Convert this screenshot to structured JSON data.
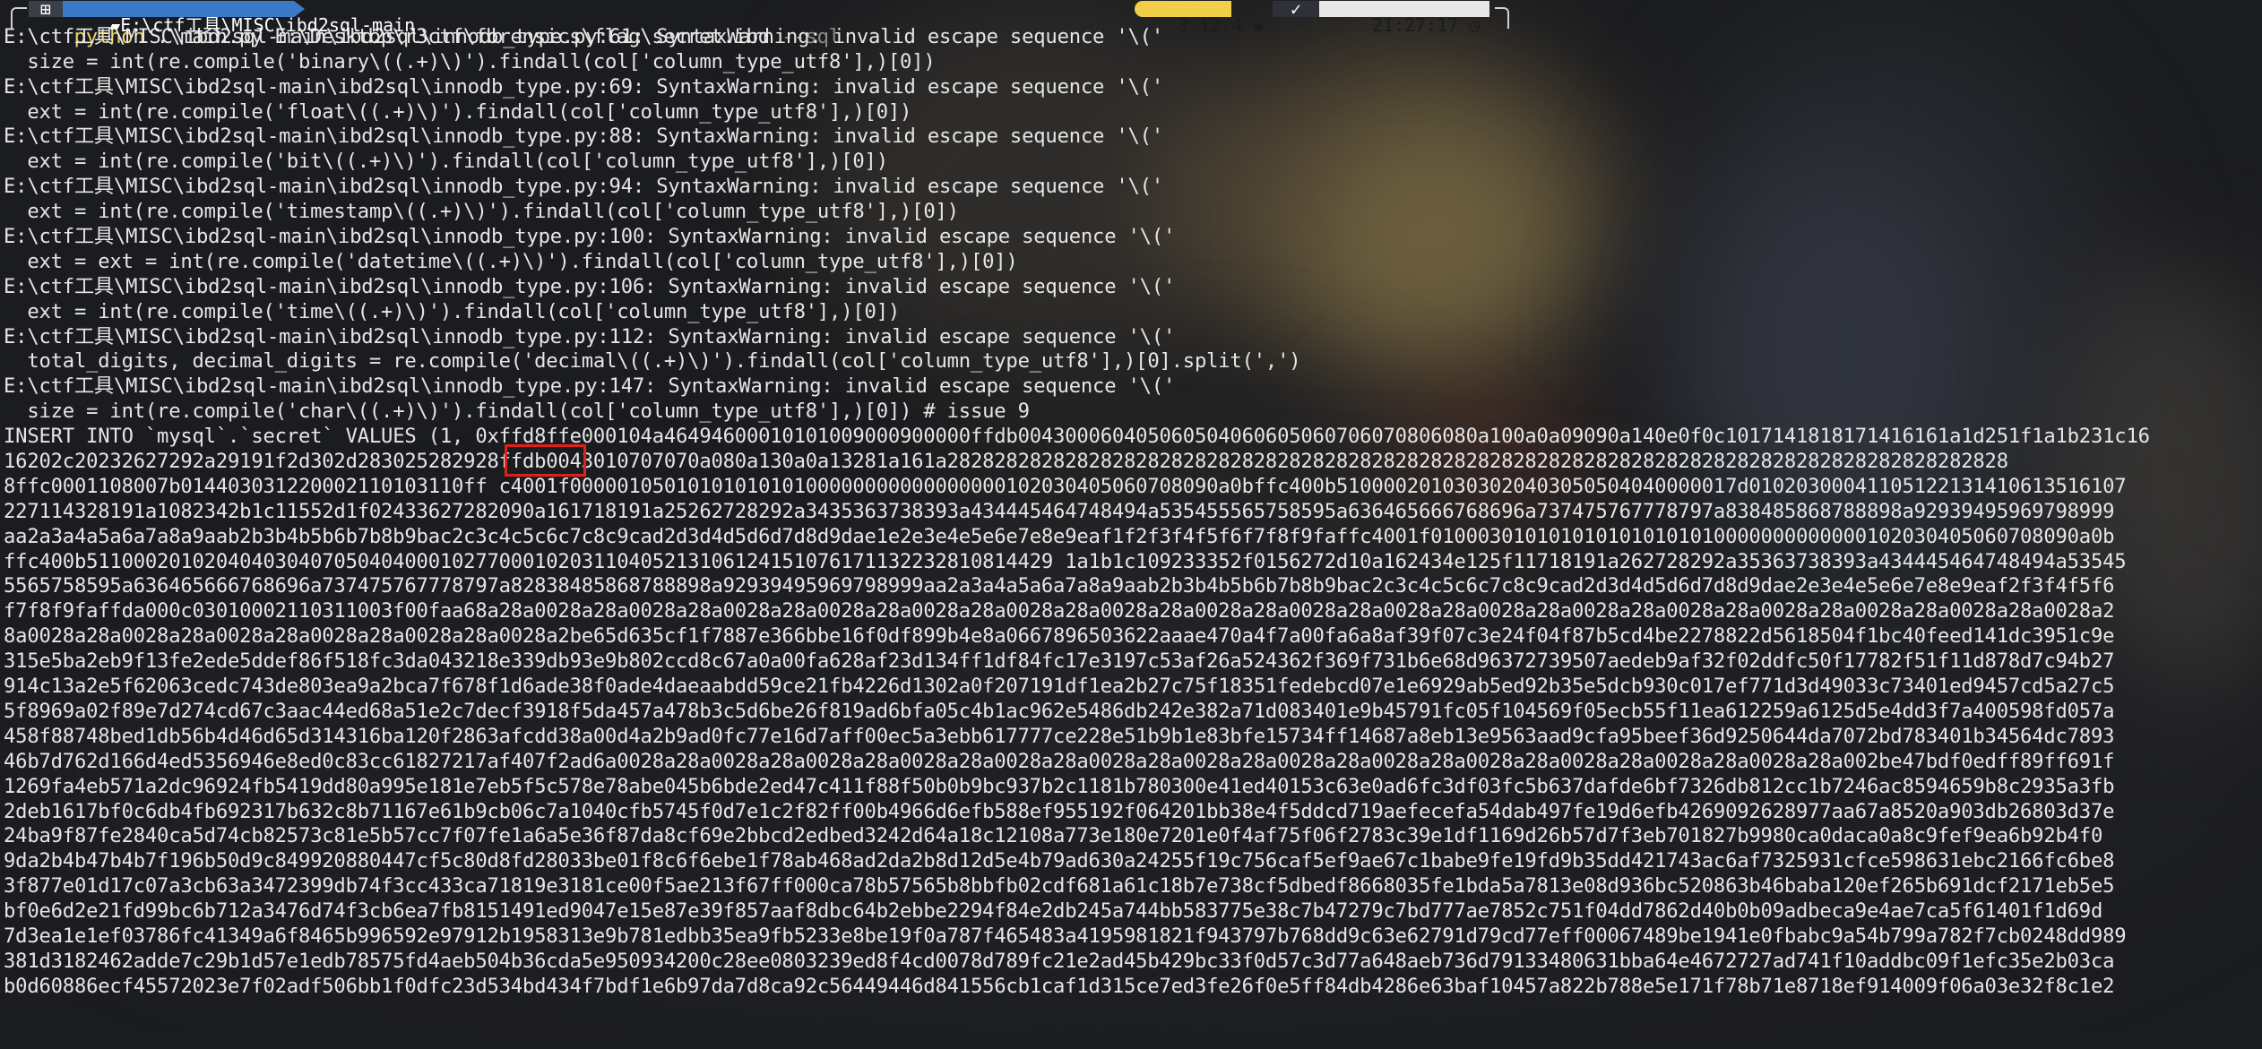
{
  "prompt": {
    "os_icon": "windows-icon",
    "folder_icon": "folder-icon",
    "path": "E:\\ctf工具\\MISC\\ibd2sql-main",
    "python_version": "3.12.4",
    "python_icon": "python-icon",
    "status_icon": "check-icon",
    "time": "21:27:17",
    "clock_icon": "clock-icon"
  },
  "command": {
    "exe": "python",
    "args": " .\\main.py E:\\Desktop\\r3ctf\\forensics\\flag\\secret.ibd ",
    "flag": "--sql"
  },
  "output_lines": [
    "E:\\ctf工具\\MISC\\ibd2sql-main\\ibd2sql\\innodb_type.py:61: SyntaxWarning: invalid escape sequence '\\('",
    "  size = int(re.compile('binary\\((.+)\\)').findall(col['column_type_utf8'],)[0])",
    "E:\\ctf工具\\MISC\\ibd2sql-main\\ibd2sql\\innodb_type.py:69: SyntaxWarning: invalid escape sequence '\\('",
    "  ext = int(re.compile('float\\((.+)\\)').findall(col['column_type_utf8'],)[0])",
    "E:\\ctf工具\\MISC\\ibd2sql-main\\ibd2sql\\innodb_type.py:88: SyntaxWarning: invalid escape sequence '\\('",
    "  ext = int(re.compile('bit\\((.+)\\)').findall(col['column_type_utf8'],)[0])",
    "E:\\ctf工具\\MISC\\ibd2sql-main\\ibd2sql\\innodb_type.py:94: SyntaxWarning: invalid escape sequence '\\('",
    "  ext = int(re.compile('timestamp\\((.+)\\)').findall(col['column_type_utf8'],)[0])",
    "E:\\ctf工具\\MISC\\ibd2sql-main\\ibd2sql\\innodb_type.py:100: SyntaxWarning: invalid escape sequence '\\('",
    "  ext = ext = int(re.compile('datetime\\((.+)\\)').findall(col['column_type_utf8'],)[0])",
    "E:\\ctf工具\\MISC\\ibd2sql-main\\ibd2sql\\innodb_type.py:106: SyntaxWarning: invalid escape sequence '\\('",
    "  ext = int(re.compile('time\\((.+)\\)').findall(col['column_type_utf8'],)[0])",
    "E:\\ctf工具\\MISC\\ibd2sql-main\\ibd2sql\\innodb_type.py:112: SyntaxWarning: invalid escape sequence '\\('",
    "  total_digits, decimal_digits = re.compile('decimal\\((.+)\\)').findall(col['column_type_utf8'],)[0].split(',')",
    "E:\\ctf工具\\MISC\\ibd2sql-main\\ibd2sql\\innodb_type.py:147: SyntaxWarning: invalid escape sequence '\\('",
    "  size = int(re.compile('char\\((.+)\\)').findall(col['column_type_utf8'],)[0]) # issue 9"
  ],
  "insert_lines": [
    "INSERT INTO `mysql`.`secret` VALUES (1, 0xffd8ffe000104a46494600010101009000900000ffdb004300060405060504060605060706070806080a100a0a09090a140e0f0c1017141818171416161a1d251f1a1b231c16",
    "16202c20232627292a29191f2d302d283025282928ffdb0043010707070a080a130a0a13281a161a282828282828282828282828282828282828282828282828282828282828282828282828282828282828282828",
    "8ffc0001108007b014403031220002110103110ff c4001f0000010501010101010100000000000000000102030405060708090a0bffc400b5100002010303020403050504040000017d01020300041105122131410613516107",
    "227114328191a1082342b1c11552d1f02433627282090a161718191a25262728292a3435363738393a434445464748494a535455565758595a636465666768696a737475767778797a838485868788898a92939495969798999",
    "aa2a3a4a5a6a7a8a9aab2b3b4b5b6b7b8b9bac2c3c4c5c6c7c8c9cad2d3d4d5d6d7d8d9dae1e2e3e4e5e6e7e8e9eaf1f2f3f4f5f6f7f8f9faffc4001f0100030101010101010101010000000000000102030405060708090a0b",
    "ffc400b5110002010204040304070504040001027700010203110405213106124151076171132232810814429 1a1b1c109233352f0156272d10a162434e125f11718191a262728292a35363738393a434445464748494a53545",
    "5565758595a636465666768696a737475767778797a82838485868788898a92939495969798999aa2a3a4a5a6a7a8a9aab2b3b4b5b6b7b8b9bac2c3c4c5c6c7c8c9cad2d3d4d5d6d7d8d9dae2e3e4e5e6e7e8e9eaf2f3f4f5f6",
    "f7f8f9faffda000c03010002110311003f00faa68a28a0028a28a0028a28a0028a28a0028a28a0028a28a0028a28a0028a28a0028a28a0028a28a0028a28a0028a28a0028a28a0028a28a0028a28a0028a28a0028a28a0028a2",
    "8a0028a28a0028a28a0028a28a0028a28a0028a28a0028a2be65d635cf1f7887e366bbe16f0df899b4e8a0667896503622aaae470a4f7a00fa6a8af39f07c3e24f04f87b5cd4be2278822d5618504f1bc40feed141dc3951c9e",
    "315e5ba2eb9f13fe2ede5ddef86f518fc3da043218e339db93e9b802ccd8c67a0a00fa628af23d134ff1df84fc17e3197c53af26a524362f369f731b6e68d96372739507aedeb9af32f02ddfc50f17782f51f11d878d7c94b27",
    "914c13a2e5f62063cedc743de803ea9a2bca7f678f1d6ade38f0ade4daeaabdd59ce21fb4226d1302a0f207191df1ea2b27c75f18351fedebcd07e1e6929ab5ed92b35e5dcb930c017ef771d3d49033c73401ed9457cd5a27c5",
    "5f8969a02f89e7d274cd67c3aac44ed68a51e2c7decf3918f5da457a478b3c5d6be26f819ad6bfa05c4b1ac962e5486db242e382a71d083401e9b45791fc05f104569f05ecb55f11ea612259a6125d5e4dd3f7a400598fd057a",
    "458f88748bed1db56b4d46d65d314316ba120f2863afcdd38a00d4a2b9ad0fc77e16d7aff00ec5a3ebb617777ce228e51b9b1e83bfe15734ff14687a8eb13e9563aad9cfa95beef36d9250644da7072bd783401b34564dc7893",
    "46b7d762d166d4ed5356946e8ed0c83cc61827217af407f2ad6a0028a28a0028a28a0028a28a0028a28a0028a28a0028a28a0028a28a0028a28a0028a28a0028a28a0028a28a0028a28a0028a28a002be47bdf0edff89ff691f",
    "1269fa4eb571a2dc96924fb5419dd80a995e181e7eb5f5c578e78abe045b6bde2ed47c411f88f50b0b9bc937b2c1181b780300e41ed40153c63e0ad6fc3df03fc5b637dafde6bf7326db812cc1b7246ac8594659b8c2935a3fb",
    "2deb1617bf0c6db4fb692317b632c8b71167e61b9cb06c7a1040cfb5745f0d7e1c2f82ff00b4966d6efb588ef955192f064201bb38e4f5ddcd719aefecefa54dab497fe19d6efb4269092628977aa67a8520a903db26803d37e",
    "24ba9f87fe2840ca5d74cb82573c81e5b57cc7f07fe1a6a5e36f87da8cf69e2bbcd2edbed3242d64a18c12108a773e180e7201e0f4af75f06f2783c39e1df1169d26b57d7f3eb701827b9980ca0daca0a8c9fef9ea6b92b4f0",
    "9da2b4b47b4b7f196b50d9c849920880447cf5c80d8fd28033be01f8c6f6ebe1f78ab468ad2da2b8d12d5e4b79ad630a24255f19c756caf5ef9ae67c1babe9fe19fd9b35dd421743ac6af7325931cfce598631ebc2166fc6be8",
    "3f877e01d17c07a3cb63a3472399db74f3cc433ca71819e3181ce00f5ae213f67ff000ca78b57565b8bbfb02cdf681a61c18b7e738cf5dbedf8668035fe1bda5a7813e08d936bc520863b46baba120ef265b691dcf2171eb5e5",
    "bf0e6d2e21fd99bc6b712a3476d74f3cb6ea7fb8151491ed9047e15e87e39f857aaf8dbc64b2ebbe2294f84e2db245a744bb583775e38c7b47279c7bd777ae7852c751f04dd7862d40b0b09adbeca9e4ae7ca5f61401f1d69d",
    "7d3ea1e1ef03786fc41349a6f8465b996592e97912b1958313e9b781edbb35ea9fb5233e8be19f0a787f465483a4195981821f943797b768dd9c63e62791d79cd77eff00067489be1941e0fbabc9a54b799a782f7cb0248dd989",
    "381d3182462adde7c29b1d57e1edb78575fd4aeb504b36cda5e950934200c28ee0803239ed8f4cd0078d789fc21e2ad45b429bc33f0d57c3d77a648aeb736d79133480631bba64e4672727ad741f10addbc09f1efc35e2b03ca",
    "b0d60886ecf45572023e7f02adf506bb1f0dfc23d534bd434f7bdf1e6b97da7d8ca92c56449446d841556cb1caf1d315ce7ed3fe26f0e5ff84db4286e63baf10457a822b788e5e171f78b71e8718ef914009f06a03e32f8c1e2"
  ],
  "highlight_text": "0xffd"
}
